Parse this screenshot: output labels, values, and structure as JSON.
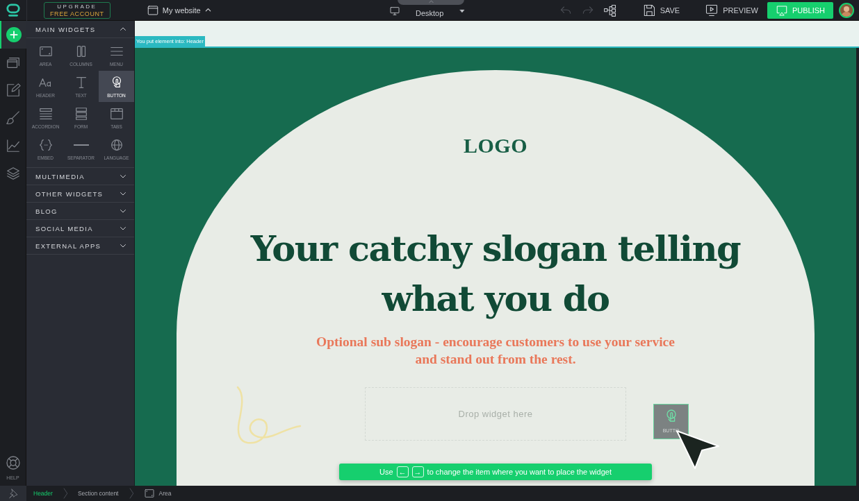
{
  "top_bar": {
    "upgrade": {
      "line1": "UPGRADE",
      "line2": "FREE ACCOUNT"
    },
    "website": "My website",
    "device": "Desktop",
    "save": "SAVE",
    "preview": "PREVIEW",
    "publish": "PUBLISH"
  },
  "rail": [
    {
      "kind": "add",
      "selected": true
    },
    {
      "kind": "pages",
      "selected": false
    },
    {
      "kind": "edit",
      "selected": false
    },
    {
      "kind": "brush",
      "selected": false
    },
    {
      "kind": "stats",
      "selected": false
    },
    {
      "kind": "layers",
      "selected": false
    }
  ],
  "help": {
    "label": "HELP"
  },
  "widget_panel": {
    "sections": [
      {
        "title": "MAIN WIDGETS",
        "expanded": true,
        "items": [
          {
            "label": "AREA",
            "kind": "area",
            "selected": false
          },
          {
            "label": "COLUMNS",
            "kind": "columns",
            "selected": false
          },
          {
            "label": "MENU",
            "kind": "menu",
            "selected": false
          },
          {
            "label": "HEADER",
            "kind": "header",
            "selected": false
          },
          {
            "label": "TEXT",
            "kind": "text",
            "selected": false
          },
          {
            "label": "BUTTON",
            "kind": "button",
            "selected": true
          },
          {
            "label": "ACCORDION",
            "kind": "accordion",
            "selected": false
          },
          {
            "label": "FORM",
            "kind": "form",
            "selected": false
          },
          {
            "label": "TABS",
            "kind": "tabs",
            "selected": false
          },
          {
            "label": "EMBED",
            "kind": "embed",
            "selected": false
          },
          {
            "label": "SEPARATOR",
            "kind": "separator",
            "selected": false
          },
          {
            "label": "LANGUAGE",
            "kind": "language",
            "selected": false
          }
        ]
      },
      {
        "title": "MULTIMEDIA",
        "expanded": false
      },
      {
        "title": "OTHER WIDGETS",
        "expanded": false
      },
      {
        "title": "BLOG",
        "expanded": false
      },
      {
        "title": "SOCIAL MEDIA",
        "expanded": false
      },
      {
        "title": "EXTERNAL APPS",
        "expanded": false
      }
    ]
  },
  "canvas": {
    "drop_notice": "You put element into: Header",
    "logo": "LOGO",
    "slogan": "Your catchy slogan telling what you do",
    "sub_slogan": "Optional sub slogan - encourage customers to use your service and stand out from the rest.",
    "drop_zone": "Drop widget here",
    "drag_ghost": "BUTTO",
    "hint": {
      "before": "Use",
      "keys": [
        "←",
        "→"
      ],
      "after": "to change the item where you want to place the widget"
    }
  },
  "breadcrumb": [
    {
      "label": "Header",
      "selected": true,
      "kind": "plain"
    },
    {
      "label": "Section content",
      "selected": false,
      "kind": "plain"
    },
    {
      "label": "Area",
      "selected": false,
      "kind": "area"
    }
  ]
}
